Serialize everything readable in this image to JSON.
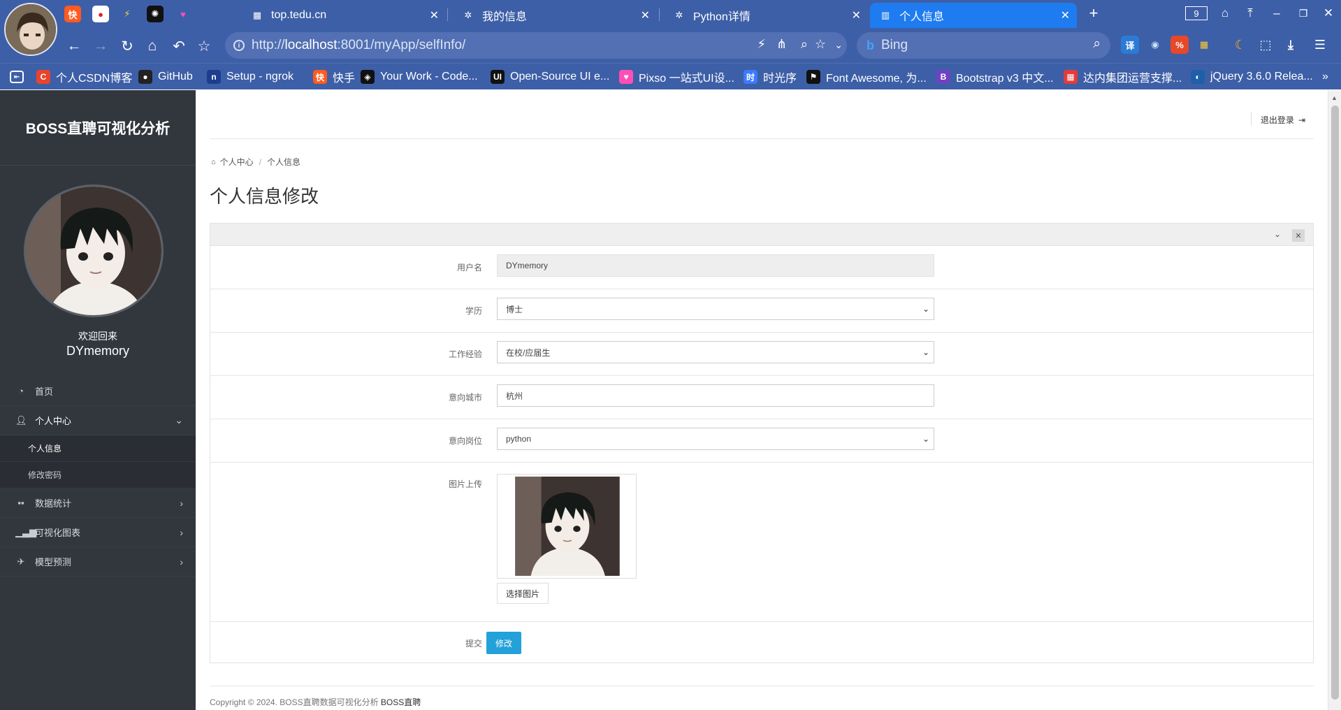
{
  "browser": {
    "tabs": [
      {
        "title": "top.tedu.cn"
      },
      {
        "title": "我的信息"
      },
      {
        "title": "Python详情"
      },
      {
        "title": "个人信息"
      }
    ],
    "tab_count": "9",
    "address": {
      "scheme": "http://",
      "host": "localhost",
      "path": ":8001/myApp/selfInfo/"
    },
    "search_placeholder": "Bing",
    "bookmarks": [
      {
        "label": "个人CSDN博客",
        "icon": "C",
        "color": "#e8442c"
      },
      {
        "label": "GitHub",
        "icon": "●",
        "color": "#222222"
      },
      {
        "label": "Setup - ngrok",
        "icon": "n",
        "color": "#1d3d8f"
      },
      {
        "label": "快手",
        "icon": "快",
        "color": "#ff5a1f"
      },
      {
        "label": "Your Work - Code...",
        "icon": "◈",
        "color": "#111111"
      },
      {
        "label": "Open-Source UI e...",
        "icon": "UI",
        "color": "#111111"
      },
      {
        "label": "Pixso 一站式UI设...",
        "icon": "♥",
        "color": "#ff4fb4"
      },
      {
        "label": "时光序",
        "icon": "时",
        "color": "#3a7bff"
      },
      {
        "label": "Font Awesome, 为...",
        "icon": "⚑",
        "color": "#111111"
      },
      {
        "label": "Bootstrap v3 中文...",
        "icon": "B",
        "color": "#6f42c1"
      },
      {
        "label": "达内集团运营支撑...",
        "icon": "▦",
        "color": "#e33b3b"
      },
      {
        "label": "jQuery 3.6.0 Relea...",
        "icon": "◐",
        "color": "#1f5fa8"
      }
    ]
  },
  "sidebar": {
    "brand": "BOSS直聘可视化分析",
    "welcome": "欢迎回来",
    "username": "DYmemory",
    "menu": [
      {
        "label": "首页",
        "icon": "dashboard-icon"
      },
      {
        "label": "个人中心",
        "icon": "user-icon"
      },
      {
        "label": "数据统计",
        "icon": "grid-icon"
      },
      {
        "label": "可视化图表",
        "icon": "bar-chart-icon"
      },
      {
        "label": "模型预测",
        "icon": "plane-icon"
      }
    ],
    "submenu": [
      {
        "label": "个人信息"
      },
      {
        "label": "修改密码"
      }
    ]
  },
  "header": {
    "logout": "退出登录"
  },
  "breadcrumb": {
    "items": [
      "个人中心",
      "个人信息"
    ]
  },
  "page": {
    "title": "个人信息修改"
  },
  "form": {
    "username_label": "用户名",
    "username_value": "DYmemory",
    "education_label": "学历",
    "education_value": "博士",
    "experience_label": "工作经验",
    "experience_value": "在校/应届生",
    "city_label": "意向城市",
    "city_value": "杭州",
    "position_label": "意向岗位",
    "position_value": "python",
    "image_label": "图片上传",
    "choose_image": "选择图片",
    "submit_label": "提交",
    "submit_button": "修改"
  },
  "footer": {
    "text": "Copyright © 2024. BOSS直聘数据可视化分析 ",
    "brand": "BOSS直聘"
  },
  "colors": {
    "browser_chrome": "#3d5fa7",
    "active_tab": "#1e7cf0",
    "sidebar": "#32373e",
    "primary_button": "#23a1d9"
  }
}
